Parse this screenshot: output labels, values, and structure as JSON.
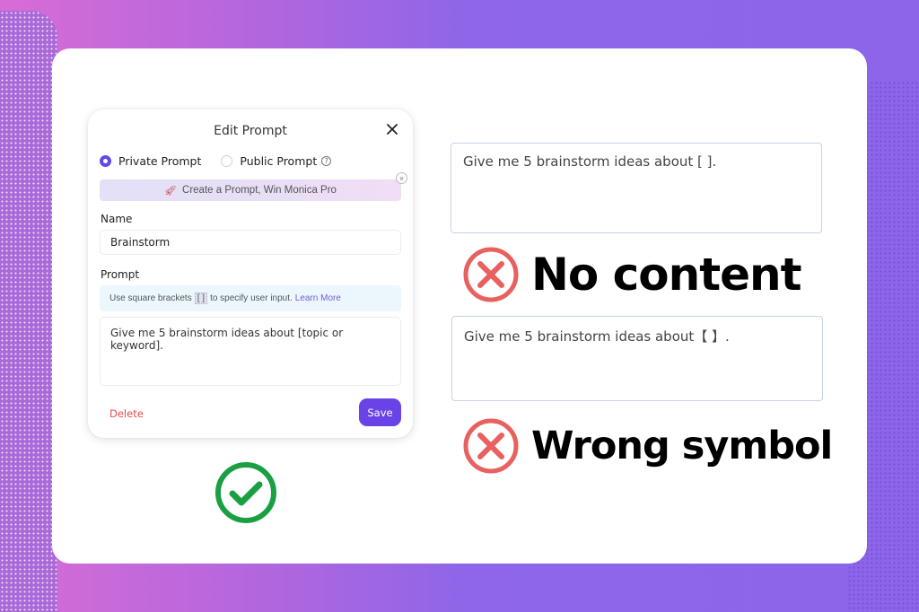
{
  "dialog": {
    "title": "Edit Prompt",
    "visibility_options": [
      {
        "label": "Private Prompt",
        "selected": true
      },
      {
        "label": "Public Prompt",
        "selected": false
      }
    ],
    "help_icon_glyph": "?",
    "promo_banner": {
      "icon": "rocket-icon",
      "text": "Create a Prompt, Win Monica Pro"
    },
    "promo_close_glyph": "×",
    "name_label": "Name",
    "name_value": "Brainstorm",
    "prompt_label": "Prompt",
    "hint": {
      "before": "Use square brackets",
      "chip": "[ ]",
      "after": "to specify user input.",
      "link": "Learn More"
    },
    "prompt_value": "Give me 5 brainstorm ideas about [topic or keyword].",
    "delete_label": "Delete",
    "save_label": "Save"
  },
  "correct_indicator": {
    "icon": "check-circle-icon",
    "color": "#1aa043"
  },
  "examples": [
    {
      "text": "Give me 5 brainstorm ideas about [ ].",
      "verdict": "No content",
      "icon": "x-circle-icon"
    },
    {
      "text": "Give me 5 brainstorm ideas about【 】.",
      "verdict": "Wrong symbol",
      "icon": "x-circle-icon"
    }
  ],
  "colors": {
    "accent": "#6a43e6",
    "danger": "#e84b4b",
    "error_icon": "#e8605f",
    "success_icon": "#1aa043"
  }
}
